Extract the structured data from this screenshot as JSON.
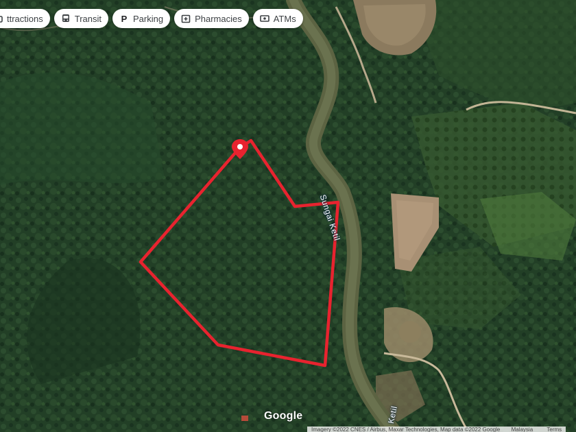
{
  "filter_chips": [
    {
      "label": "ttractions",
      "icon": "camera-icon"
    },
    {
      "label": "Transit",
      "icon": "bus-icon"
    },
    {
      "label": "Parking",
      "icon": "parking-icon"
    },
    {
      "label": "Pharmacies",
      "icon": "pharmacy-icon"
    },
    {
      "label": "ATMs",
      "icon": "atm-icon"
    }
  ],
  "map": {
    "river_labels": [
      "Sungai Ketil",
      "Ketil"
    ],
    "google_logo": "Google",
    "attribution": {
      "text": "Imagery ©2022 CNES / Airbus, Maxar Technologies, Map data ©2022 Google",
      "region": "Malaysia",
      "terms": "Terms"
    },
    "boundary_color": "#e8232f",
    "marker_color": "#e8232f"
  }
}
